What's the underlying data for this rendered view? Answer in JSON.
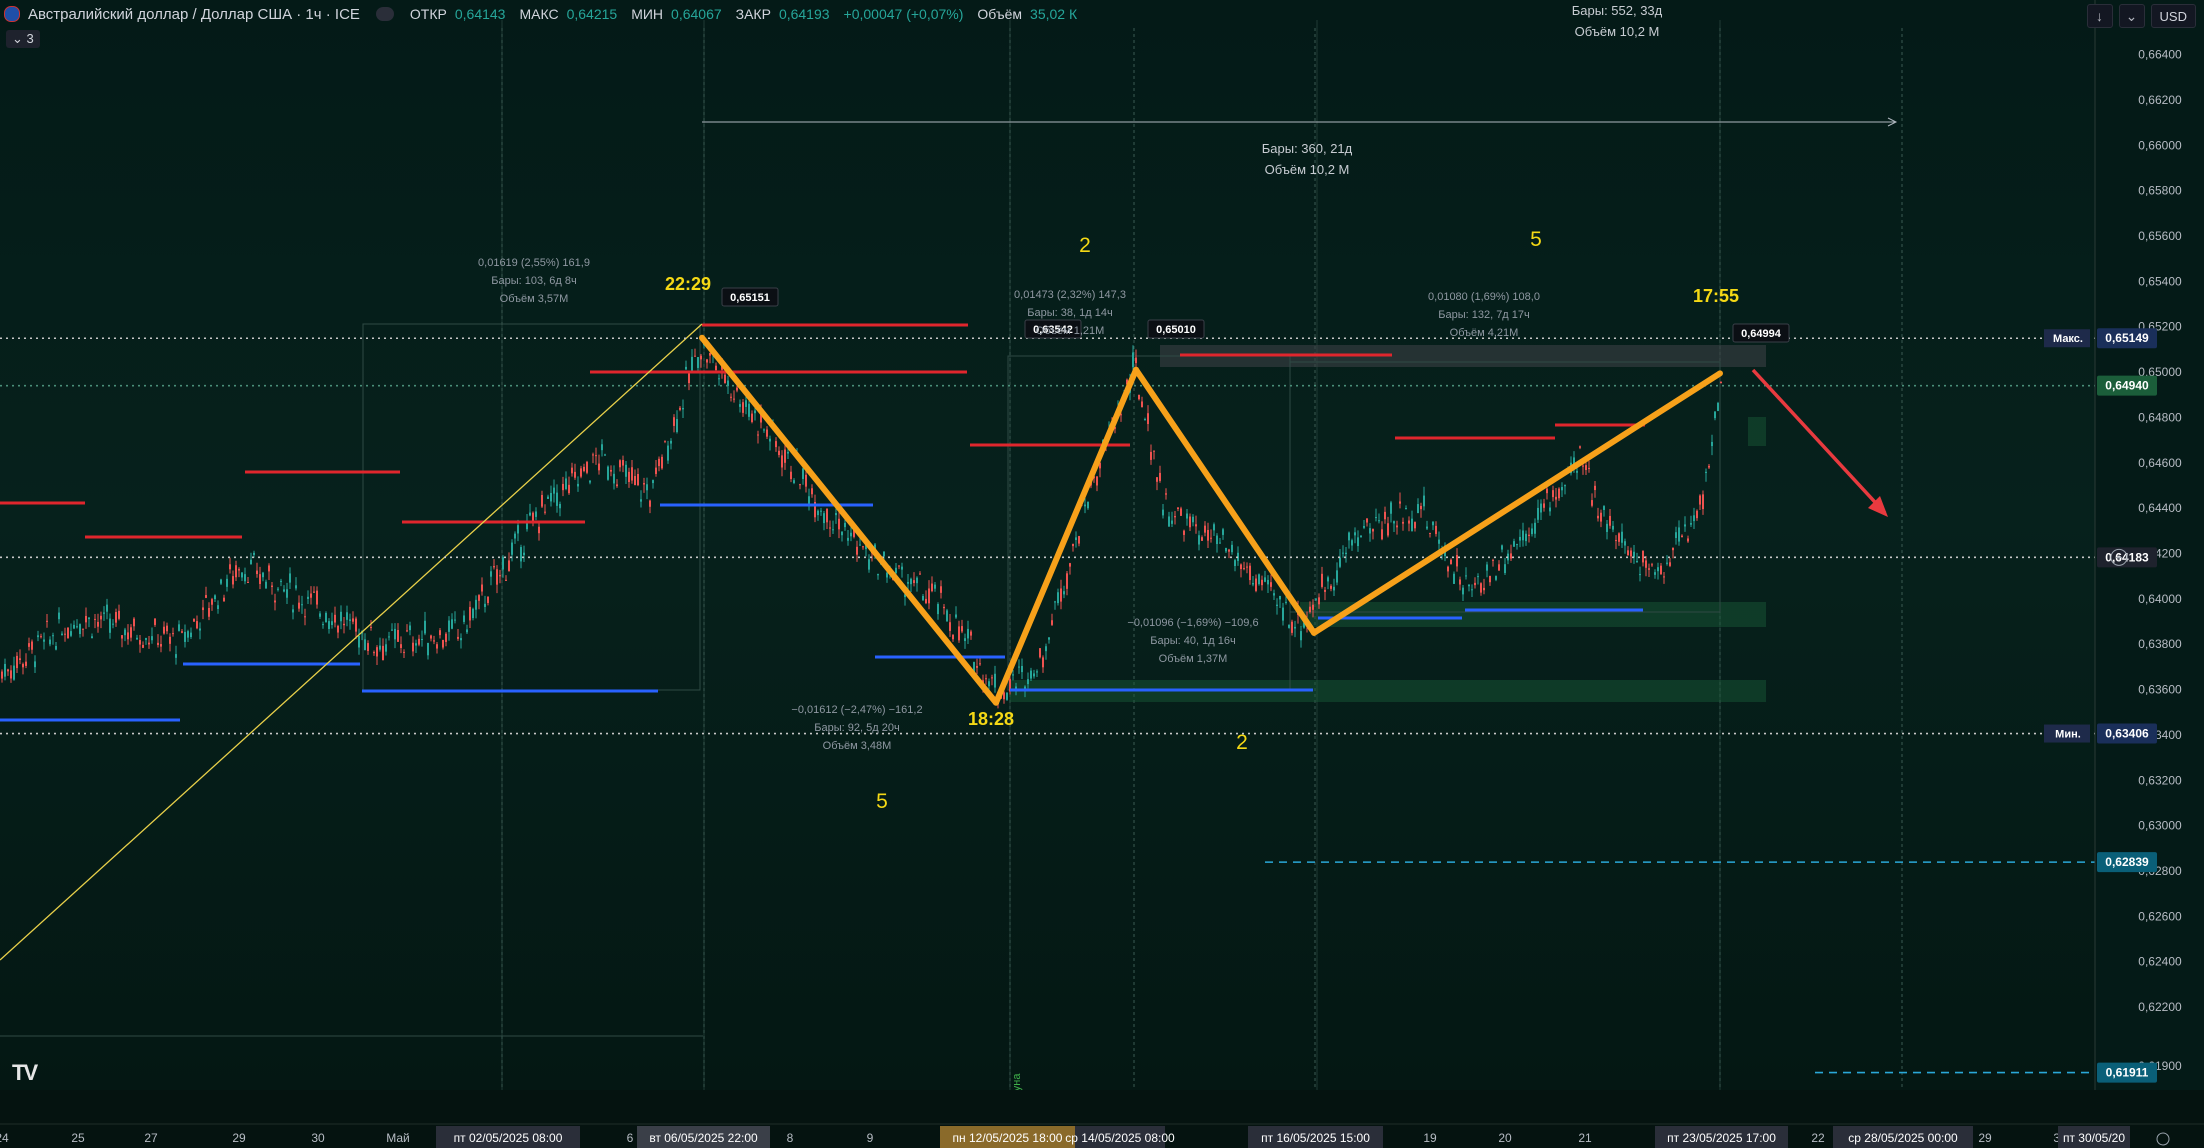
{
  "header": {
    "symbol": "Австралийский доллар / Доллар США · 1ч · ICE",
    "open_label": "ОТКР",
    "open": "0,64143",
    "high_label": "МАКС",
    "high": "0,64215",
    "low_label": "МИН",
    "low": "0,64067",
    "close_label": "ЗАКР",
    "close": "0,64193",
    "change": "+0,00047 (+0,07%)",
    "volume_label": "Объём",
    "volume": "35,02 К",
    "sub_count": "3",
    "currency": "USD",
    "down_icon": "arrow-down-icon",
    "more_icon": "chevron-down-icon"
  },
  "colors": {
    "background": "#041a17",
    "accent_orange": "#f7a11a",
    "resistance_red": "#e0262d",
    "support_blue": "#2962ff",
    "label_yellow": "#f5d915",
    "arrow_red": "#e83a3f",
    "zone_green": "#1b5e3a"
  },
  "chart_data": {
    "type": "line",
    "title": "Австралийский доллар / Доллар США · 1ч · ICE",
    "ylim": [
      0.6182,
      0.6676
    ],
    "y_ticks": [
      "0,66400",
      "0,66200",
      "0,66000",
      "0,65800",
      "0,65600",
      "0,65400",
      "0,65200",
      "0,65000",
      "0,64800",
      "0,64600",
      "0,64400",
      "0,64200",
      "0,64000",
      "0,63800",
      "0,63600",
      "0,63400",
      "0,63200",
      "0,63000",
      "0,62800",
      "0,62600",
      "0,62400",
      "0,62200",
      "0,61900"
    ],
    "x_ticks": [
      "24",
      "25",
      "27",
      "29",
      "30",
      "Май",
      "6",
      "8",
      "9",
      "19",
      "20",
      "21",
      "22",
      "27",
      "29",
      "30"
    ],
    "x_highlight_labels": [
      "пт 02/05/2025   08:00",
      "вт 06/05/2025   22:00",
      "пн 12/05/2025   18:00",
      "ср 14/05/2025   08:00",
      "пт 16/05/2025   15:00",
      "пт 23/05/2025   17:00",
      "ср 28/05/2025   00:00",
      "пт 30/05/20"
    ],
    "price_labels": [
      {
        "label": "Макс.",
        "value": "0,65149"
      },
      {
        "label": "",
        "value": "0,64940"
      },
      {
        "label": "",
        "value": "0,64183"
      },
      {
        "label": "Мин.",
        "value": "0,63406"
      },
      {
        "label": "",
        "value": "0,62839"
      },
      {
        "label": "",
        "value": "0,61911"
      }
    ],
    "series": [
      {
        "name": "",
        "values": [
          0.65151,
          0.63542,
          0.6501,
          0.6385,
          0.64994
        ],
        "x": [
          "06/05/2025 22:29",
          "12/05/2025 18:28",
          "14/05/2025 08:00",
          "16/05/2025 15:00",
          "23/05/2025 17:55"
        ]
      }
    ],
    "point_labels": [
      "0,65151",
      "0,63542",
      "0,65010",
      "0,64994"
    ],
    "time_labels": [
      "22:29",
      "18:28",
      "17:55"
    ],
    "wave_labels": [
      "2",
      "5",
      "2",
      "5"
    ],
    "measure_boxes": [
      {
        "lines": [
          "0,01619 (2,55%) 161,9",
          "Бары: 103, 6д 8ч",
          "Объём 3,57M"
        ]
      },
      {
        "lines": [
          "−0,01612 (−2,47%) −161,2",
          "Бары: 92, 5д 20ч",
          "Объём 3,48M"
        ]
      },
      {
        "lines": [
          "0,01473 (2,32%) 147,3",
          "Бары: 38, 1д 14ч",
          "Объём 1,21M"
        ]
      },
      {
        "lines": [
          "−0,01096 (−1,69%) −109,6",
          "Бары: 40, 1д 16ч",
          "Объём 1,37M"
        ]
      },
      {
        "lines": [
          "0,01080 (1,69%) 108,0",
          "Бары: 132, 7д 17ч",
          "Объём 4,21M"
        ]
      }
    ],
    "range_info": [
      {
        "lines": [
          "Бары: 552, 33д",
          "Объём 10,2 M"
        ]
      },
      {
        "lines": [
          "Бары: 360, 21д",
          "Объём 10,2 M"
        ]
      }
    ],
    "moon_label": "Луна",
    "grid": true
  }
}
